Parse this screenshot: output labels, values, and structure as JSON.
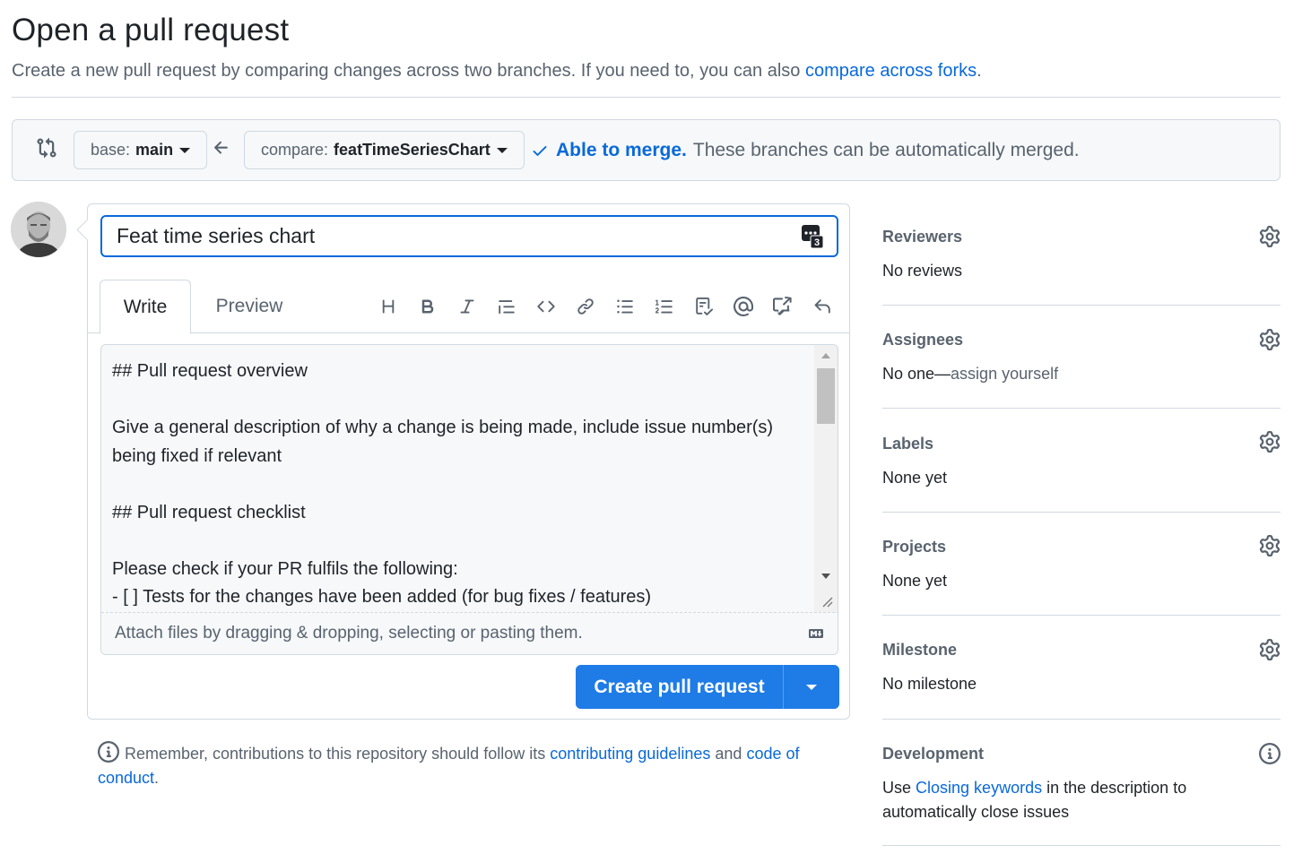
{
  "header": {
    "title": "Open a pull request",
    "subtitle": "Create a new pull request by comparing changes across two branches. If you need to, you can also",
    "subtitle_link": "compare across forks",
    "subtitle_end": "."
  },
  "range": {
    "base_label": "base:",
    "base_value": "main",
    "compare_label": "compare:",
    "compare_value": "featTimeSeriesChart",
    "merge_status": "Able to merge.",
    "merge_detail": "These branches can be automatically merged."
  },
  "form": {
    "title_value": "Feat time series chart",
    "saved_replies_count": "3",
    "tabs": [
      {
        "label": "Write"
      },
      {
        "label": "Preview"
      }
    ],
    "body_text": "## Pull request overview\n\nGive a general description of why a change is being made, include issue number(s) being fixed if relevant\n\n## Pull request checklist\n\nPlease check if your PR fulfils the following:\n- [ ] Tests for the changes have been added (for bug fixes / features)",
    "attach_hint": "Attach files by dragging & dropping, selecting or pasting them.",
    "submit_label": "Create pull request"
  },
  "toolbar_icons": [
    "heading-icon",
    "bold-icon",
    "italic-icon",
    "quote-icon",
    "code-icon",
    "link-icon",
    "unordered-list-icon",
    "ordered-list-icon",
    "task-list-icon",
    "mention-icon",
    "reference-icon",
    "undo-icon"
  ],
  "footer": {
    "text_start": "Remember, contributions to this repository should follow its",
    "link1": "contributing guidelines",
    "text_mid": "and",
    "link2": "code of conduct",
    "text_end": "."
  },
  "sidebar": {
    "reviewers": {
      "heading": "Reviewers",
      "value": "No reviews"
    },
    "assignees": {
      "heading": "Assignees",
      "value": "No one—",
      "action": "assign yourself"
    },
    "labels": {
      "heading": "Labels",
      "value": "None yet"
    },
    "projects": {
      "heading": "Projects",
      "value": "None yet"
    },
    "milestone": {
      "heading": "Milestone",
      "value": "No milestone"
    },
    "development": {
      "heading": "Development",
      "text_start": "Use",
      "link": "Closing keywords",
      "text_end": "in the description to automatically close issues"
    }
  },
  "colors": {
    "accent": "#0969da",
    "primary_button": "#1f7ce6",
    "border": "#d1d9e0",
    "muted_text": "#59636e"
  }
}
